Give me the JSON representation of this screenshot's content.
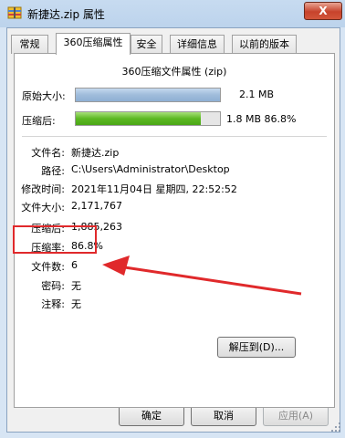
{
  "window": {
    "title": "新捷达.zip 属性",
    "close_label": "X"
  },
  "tabs": [
    {
      "label": "常规",
      "active": false
    },
    {
      "label": "360压缩属性",
      "active": true
    },
    {
      "label": "安全",
      "active": false
    },
    {
      "label": "详细信息",
      "active": false
    },
    {
      "label": "以前的版本",
      "active": false
    }
  ],
  "panel": {
    "title": "360压缩文件属性 (zip)",
    "original_size": {
      "label": "原始大小:",
      "value": "2.1 MB",
      "fill_fraction": 1.0
    },
    "compressed": {
      "label": "压缩后:",
      "value": "1.8 MB 86.8%",
      "fill_fraction": 0.868
    },
    "info": [
      {
        "label": "文件名:",
        "value": "新捷达.zip"
      },
      {
        "label": "路径:",
        "value": "C:\\Users\\Administrator\\Desktop"
      },
      {
        "label": "修改时间:",
        "value": "2021年11月04日 星期四, 22:52:52"
      },
      {
        "label": "文件大小:",
        "value": "2,171,767"
      },
      {
        "label": "压缩后:",
        "value": "1,885,263"
      },
      {
        "label": "压缩率:",
        "value": "86.8%"
      },
      {
        "label": "文件数:",
        "value": "6"
      },
      {
        "label": "密码:",
        "value": "无"
      },
      {
        "label": "注释:",
        "value": "无"
      }
    ],
    "extract_button": "解压到(D)..."
  },
  "buttons": {
    "ok": "确定",
    "cancel": "取消",
    "apply": "应用(A)"
  },
  "colors": {
    "annotation": "#e0292b",
    "bar_blue": "#9fbcdb",
    "bar_green": "#5cb823"
  }
}
